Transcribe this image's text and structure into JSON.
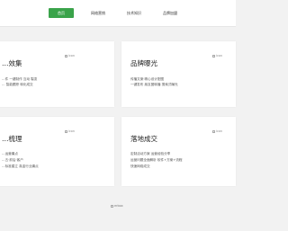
{
  "nav": {
    "items": [
      {
        "label": "首页",
        "active": true
      },
      {
        "label": "网络营销"
      },
      {
        "label": "技术知识"
      },
      {
        "label": "品牌加盟"
      }
    ]
  },
  "cards": [
    {
      "title": "…效集",
      "lines": [
        "…件 一键制作 互动 裂变",
        "… 智能跟踪 转化成交"
      ],
      "icon_alt": "icon"
    },
    {
      "title": "品牌曝光",
      "lines": [
        "传播文案·精心设计配图",
        "一键发布 朋友圈转播 搜索式曝光"
      ],
      "icon_alt": "icon"
    },
    {
      "title": "…梳理",
      "lines": [
        "…运营痛点",
        "…五·前后·客户",
        "…标准建立 真金行业痛点"
      ],
      "icon_alt": "icon"
    },
    {
      "title": "落地成交",
      "lines": [
        "定制活动方案 运营经验分享",
        "运营问题全面解析 软件+方案+流程",
        "快速网络成交"
      ],
      "icon_alt": "icon"
    }
  ],
  "footer": {
    "img_alt": "erbox"
  }
}
